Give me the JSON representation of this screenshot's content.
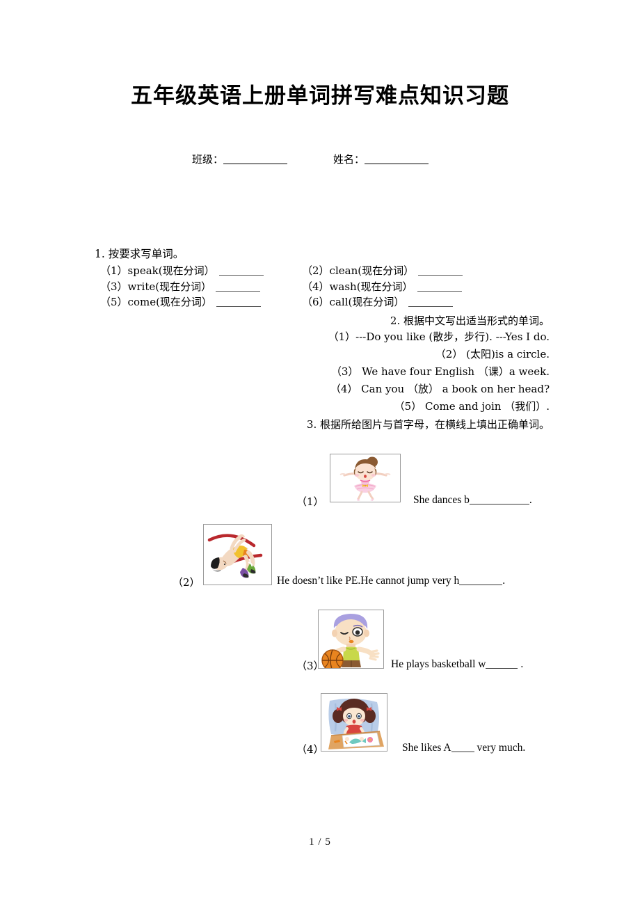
{
  "document": {
    "title": "五年级英语上册单词拼写难点知识习题",
    "meta": {
      "class_label": "班级：",
      "name_label": "姓名："
    },
    "footer": "1 / 5"
  },
  "section1": {
    "heading": "1. 按要求写单词。",
    "items": [
      {
        "num": "（1）",
        "prompt": "speak(现在分词）"
      },
      {
        "num": "（2）",
        "prompt": "clean(现在分词）"
      },
      {
        "num": "（3）",
        "prompt": "write(现在分词）"
      },
      {
        "num": "（4）",
        "prompt": "wash(现在分词）"
      },
      {
        "num": "（5）",
        "prompt": "come(现在分词）"
      },
      {
        "num": "（6）",
        "prompt": "call(现在分词）"
      }
    ]
  },
  "section2": {
    "heading": "2. 根据中文写出适当形式的单词。",
    "items": [
      "（1）---Do you like (散步，步行). ---Yes I do.",
      "（2） (太阳)is a circle.",
      "（3） We have four English （课）a week.",
      "（4） Can you （放） a book on her head?",
      "（5） Come and join （我们）."
    ]
  },
  "section3": {
    "heading": "3. 根据所给图片与首字母，在横线上填出正确单词。",
    "items": [
      {
        "num": "（1）",
        "picture": "ballerina-girl-dancing-picture",
        "text_before": "She dances b",
        "text_after": ".",
        "blank_width": 86
      },
      {
        "num": "（2）",
        "picture": "high-jump-athlete-picture",
        "text_before": "He doesn’t like PE.He cannot jump very h",
        "text_after": ".",
        "blank_width": 62
      },
      {
        "num": "（3）",
        "picture": "boy-playing-basketball-picture",
        "text_before": "He plays basketball w",
        "text_after": " .",
        "blank_width": 46
      },
      {
        "num": "（4）",
        "picture": "girl-drawing-art-picture",
        "text_before": "She likes A",
        "text_after": " very much.",
        "blank_width": 33
      }
    ]
  },
  "colors": {
    "page_background": "#ffffff",
    "text": "#000000",
    "frame_border": "#9a9a9a",
    "blank_rule": "#555555",
    "ballerina_hair": "#8a5a32",
    "ballerina_dress": "#f6b9d4",
    "jumper_bar": "#b9282d",
    "jumper_singlet": "#f2c12e",
    "basketball_hair": "#a9a0e0",
    "basketball_ball": "#e8841f",
    "basketball_shirt": "#c8d84a",
    "drawing_background": "#b9cde8",
    "drawing_desk": "#e0a462",
    "drawing_shirt": "#d8453f"
  }
}
